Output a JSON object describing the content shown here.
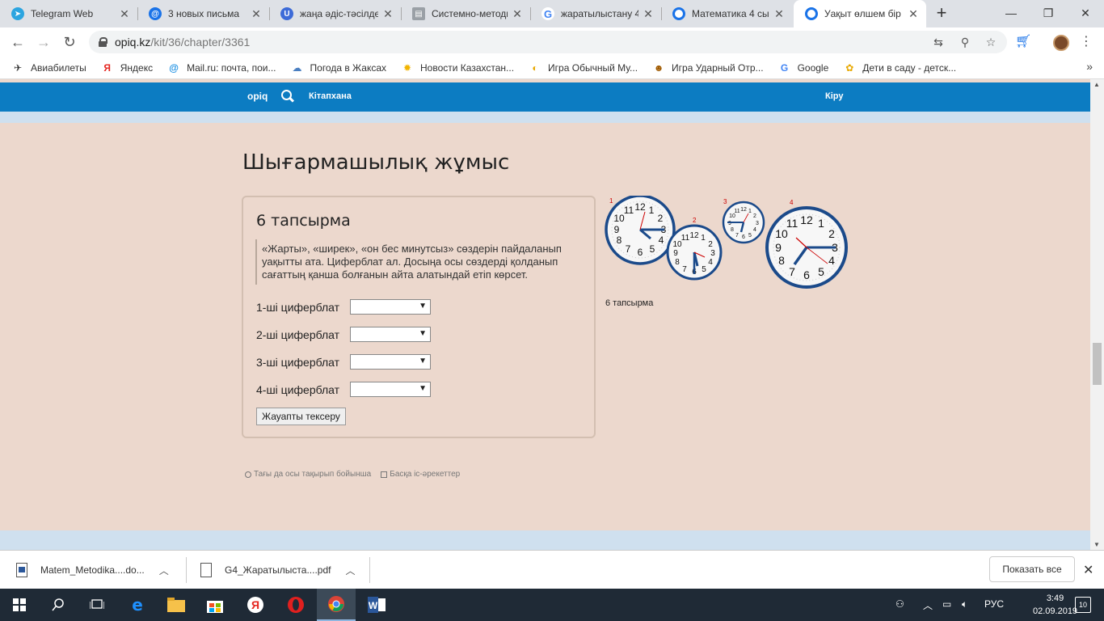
{
  "tabs": [
    {
      "title": "Telegram Web",
      "color": "#2ca5e0",
      "glyph": "➤"
    },
    {
      "title": "3 новых письма",
      "color": "#1a73e8",
      "glyph": "@"
    },
    {
      "title": "жаңа әдіс-тәсілде",
      "color": "#3d6bd8",
      "glyph": "U"
    },
    {
      "title": "Системно-методи",
      "color": "#9aa0a6",
      "glyph": "▤"
    },
    {
      "title": "жаратылыстану 4",
      "color": "#ffffff",
      "glyph": "G"
    },
    {
      "title": "Математика 4 сы",
      "color": "#1a73e8",
      "glyph": "○"
    },
    {
      "title": "Уақыт өлшем бір",
      "color": "#1a73e8",
      "glyph": "○"
    }
  ],
  "address": {
    "domain": "opiq.kz",
    "path": "/kit/36/chapter/3361"
  },
  "bookmarks": [
    {
      "label": "Авиабилеты",
      "icon": "plane-icon",
      "glyph": "✈",
      "color": "#333333"
    },
    {
      "label": "Яндекс",
      "icon": "yandex-icon",
      "glyph": "Я",
      "color": "#e52620"
    },
    {
      "label": "Mail.ru: почта, пои...",
      "icon": "mailru-icon",
      "glyph": "@",
      "color": "#168de2"
    },
    {
      "label": "Погода в Жаксах",
      "icon": "weather-icon",
      "glyph": "☁",
      "color": "#4a7fc1"
    },
    {
      "label": "Новости Казахстан...",
      "icon": "sun-icon",
      "glyph": "✹",
      "color": "#f2b400"
    },
    {
      "label": "Игра Обычный Му...",
      "icon": "game-icon",
      "glyph": "◐",
      "color": "#e8a800"
    },
    {
      "label": "Игра Ударный Отр...",
      "icon": "owl-icon",
      "glyph": "☻",
      "color": "#a05a00"
    },
    {
      "label": "Google",
      "icon": "google-icon",
      "glyph": "G",
      "color": "#4285f4"
    },
    {
      "label": "Дети в саду - детск...",
      "icon": "kids-icon",
      "glyph": "✿",
      "color": "#e8a800"
    }
  ],
  "bookmarks_more": "»",
  "site": {
    "logo": "opiq",
    "library": "Кітапхана",
    "login": "Кіру"
  },
  "page": {
    "heading": "Шығармашылық жұмыс",
    "task_title": "6 тапсырма",
    "task_text": "«Жарты», «ширек», «он бес минутсыз» сөздерін пайдаланып уақытты ата. Циферблат ал. Досыңа осы сөздерді қолданып сағаттың қанша болғанын айта алатындай етіп көрсет.",
    "rows": [
      {
        "label": "1-ші циферблат",
        "value": ""
      },
      {
        "label": "2-ші циферблат",
        "value": ""
      },
      {
        "label": "3-ші циферблат",
        "value": ""
      },
      {
        "label": "4-ші циферблат",
        "value": ""
      }
    ],
    "check_button": "Жауапты тексеру",
    "image_caption": "6 тапсырма",
    "clock_numbers": [
      "1",
      "2",
      "3",
      "4"
    ],
    "more_on_topic": "Тағы да осы тақырып бойынша",
    "other_actions": "Басқа іс-әрекеттер"
  },
  "downloads": [
    {
      "name": "Matem_Metodika....do...",
      "type": "doc"
    },
    {
      "name": "G4_Жаратылыста....pdf",
      "type": "pdf"
    }
  ],
  "show_all": "Показать все",
  "taskbar": {
    "lang": "РУС",
    "time": "3:49",
    "date": "02.09.2019",
    "notifications": "10"
  }
}
